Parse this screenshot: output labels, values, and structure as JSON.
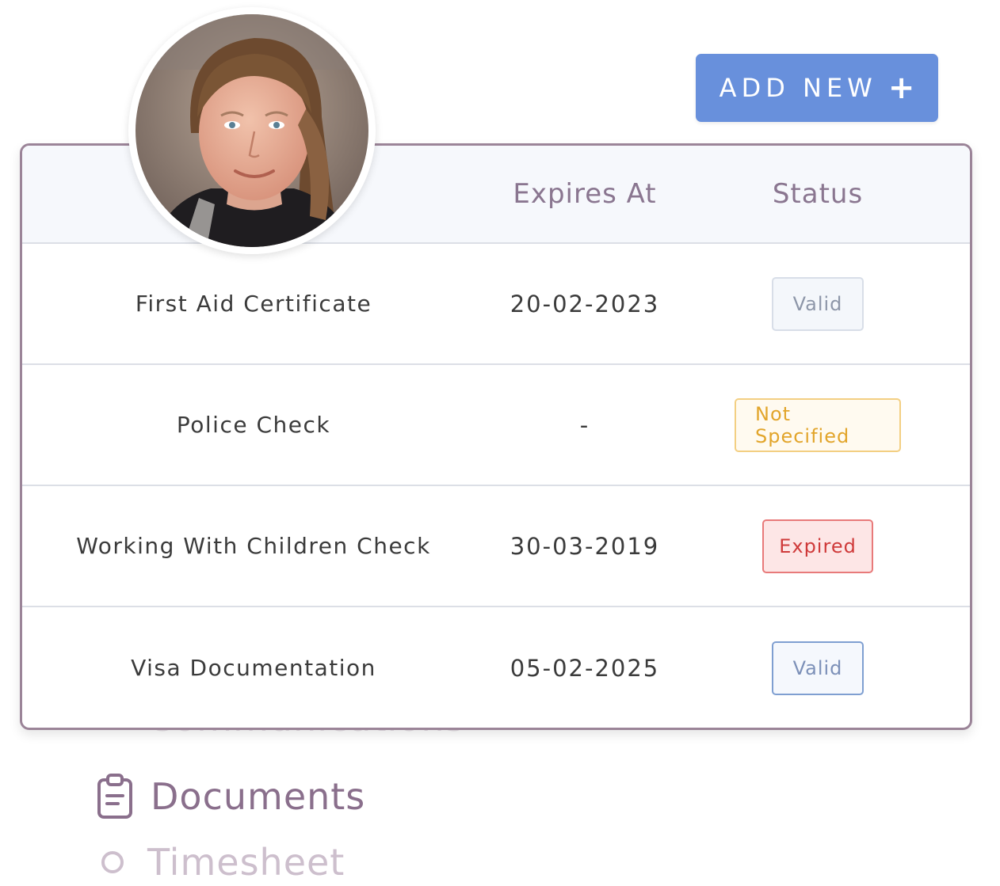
{
  "header": {
    "add_button_label": "ADD NEW",
    "add_button_icon": "plus-icon"
  },
  "table": {
    "columns": [
      "",
      "Expires At",
      "Status"
    ],
    "rows": [
      {
        "name": "First Aid Certificate",
        "expires": "20-02-2023",
        "status": "Valid"
      },
      {
        "name": "Police Check",
        "expires": "-",
        "status": "Not Specified"
      },
      {
        "name": "Working With Children Check",
        "expires": "30-03-2019",
        "status": "Expired"
      },
      {
        "name": "Visa Documentation",
        "expires": "05-02-2025",
        "status": "Valid"
      }
    ]
  },
  "nav": {
    "items": [
      {
        "label": "Communications",
        "icon": "circle-icon"
      },
      {
        "label": "Documents",
        "icon": "clipboard-icon",
        "active": true
      },
      {
        "label": "Timesheet",
        "icon": "circle-icon"
      }
    ]
  },
  "colors": {
    "accent": "#6890dc",
    "border": "#9b8498",
    "warning": "#e2a52b",
    "danger": "#cf3a3a"
  }
}
